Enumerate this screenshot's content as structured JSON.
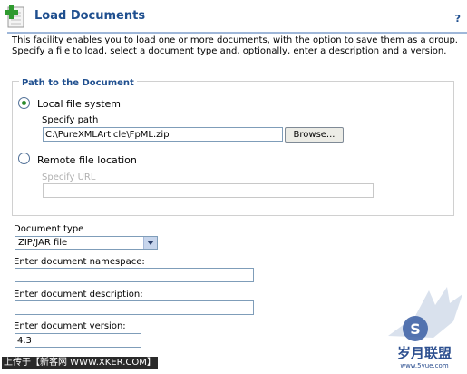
{
  "header": {
    "title": "Load Documents",
    "help_label": "?"
  },
  "description": "This facility enables you to load one or more documents, with the option to save them as a group. Specify a file to load, select a document type and, optionally, enter a description and a version.",
  "path_group": {
    "legend": "Path to the Document",
    "local_option": {
      "label": "Local file system",
      "selected": true,
      "path_label": "Specify path",
      "path_value": "C:\\PureXMLArticle\\FpML.zip",
      "browse_label": "Browse..."
    },
    "remote_option": {
      "label": "Remote file location",
      "selected": false,
      "url_label": "Specify URL",
      "url_value": ""
    }
  },
  "document_type": {
    "label": "Document type",
    "selected": "ZIP/JAR file"
  },
  "namespace": {
    "label": "Enter document namespace:",
    "value": ""
  },
  "doc_description": {
    "label": "Enter document description:",
    "value": ""
  },
  "version": {
    "label": "Enter document version:",
    "value": "4.3"
  },
  "watermark": {
    "text": "上传于【新客网 WWW.XKER.COM】",
    "logo_text": "岁月联盟",
    "logo_url": "www.5yue.com"
  },
  "colors": {
    "accent": "#1f4f8f",
    "rule": "#9fb7d9",
    "radio_dot": "#2a8a2a"
  }
}
